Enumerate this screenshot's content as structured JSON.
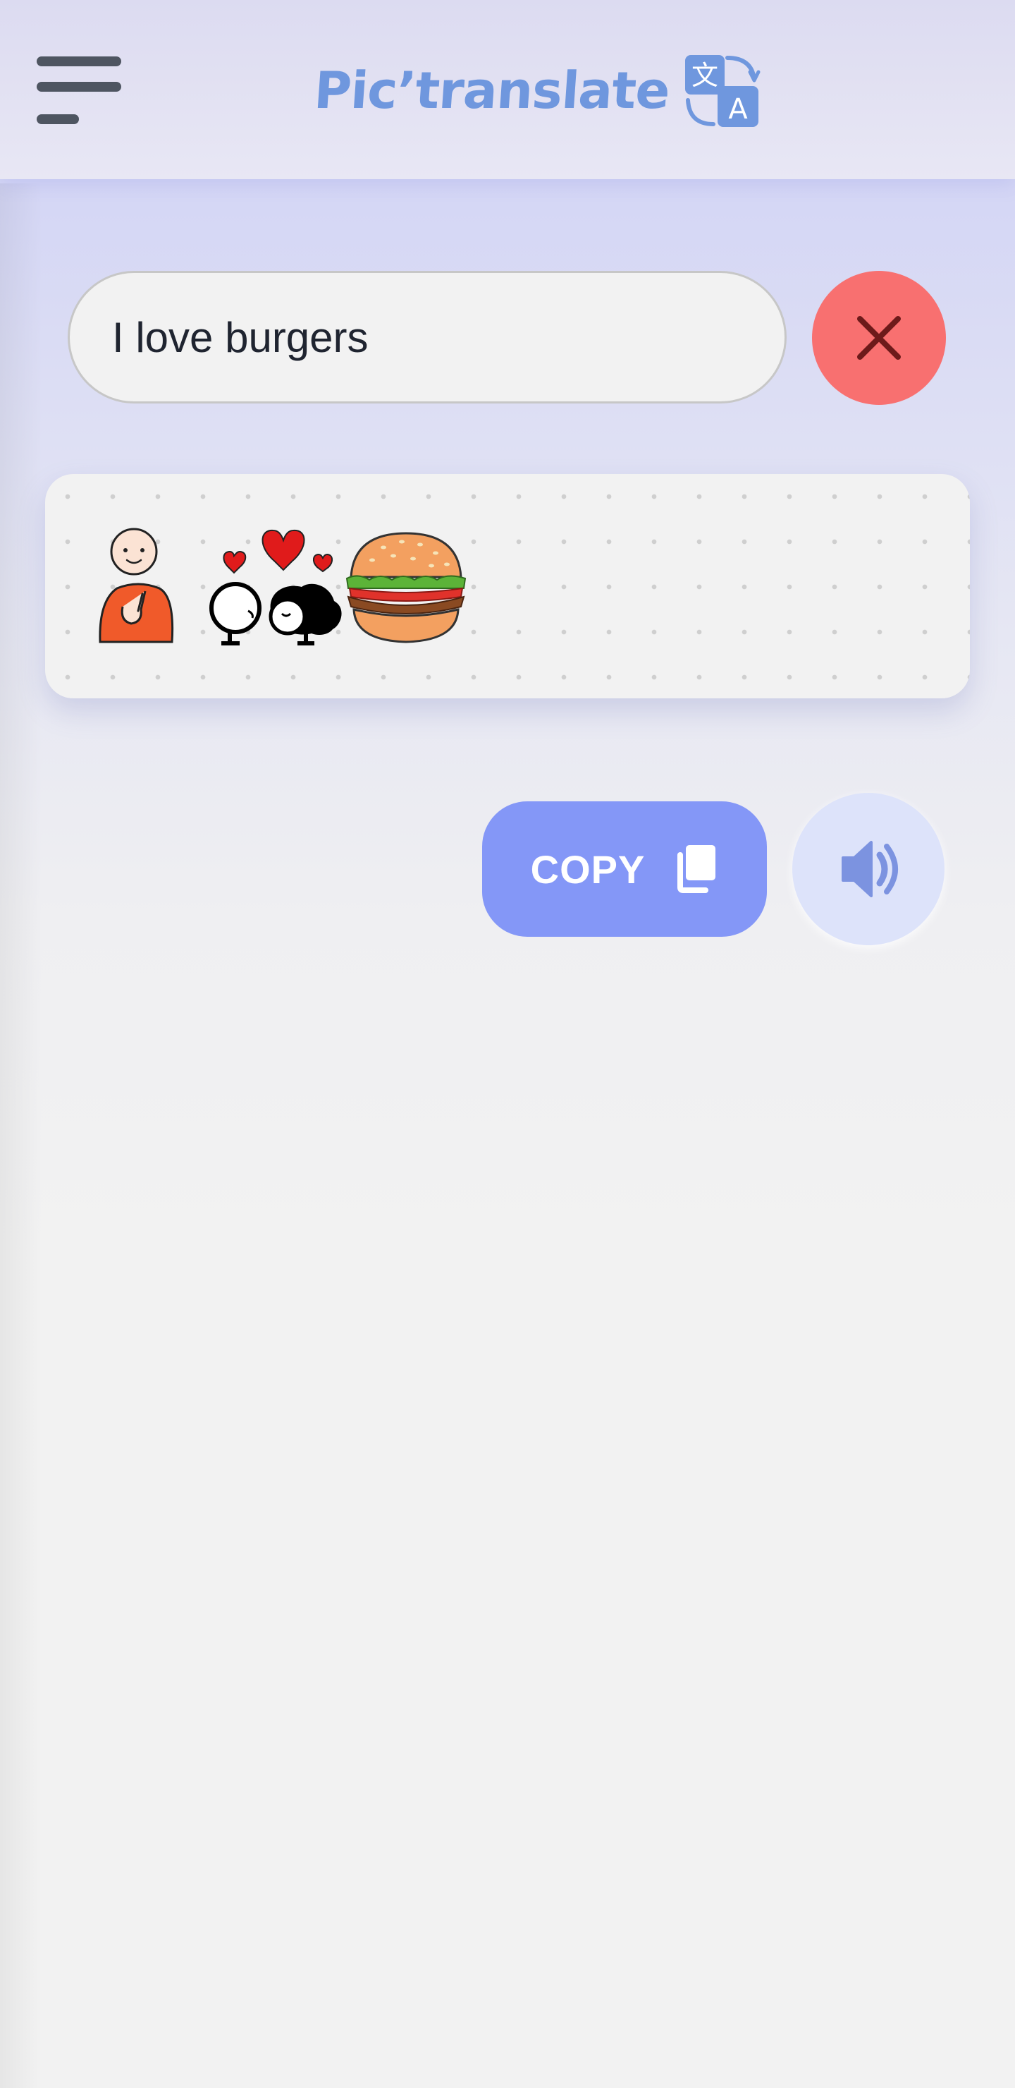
{
  "header": {
    "brand_name": "Pic’translate",
    "menu_icon": "hamburger-menu-icon",
    "logo_icon": "translate-icon",
    "logo_glyph_top": "文",
    "logo_glyph_bottom": "A",
    "brand_color": "#6f97de"
  },
  "search": {
    "value": "I love burgers",
    "clear_icon": "close-icon",
    "clear_color": "#f87070"
  },
  "pictograms": [
    {
      "icon": "person-me-pictogram"
    },
    {
      "icon": "love-couple-hearts-pictogram"
    },
    {
      "icon": "burger-pictogram"
    }
  ],
  "actions": {
    "copy_label": "COPY",
    "copy_icon": "copy-icon",
    "copy_color": "#8497f7",
    "speak_icon": "speaker-icon",
    "speak_bg": "#dde3fa"
  }
}
